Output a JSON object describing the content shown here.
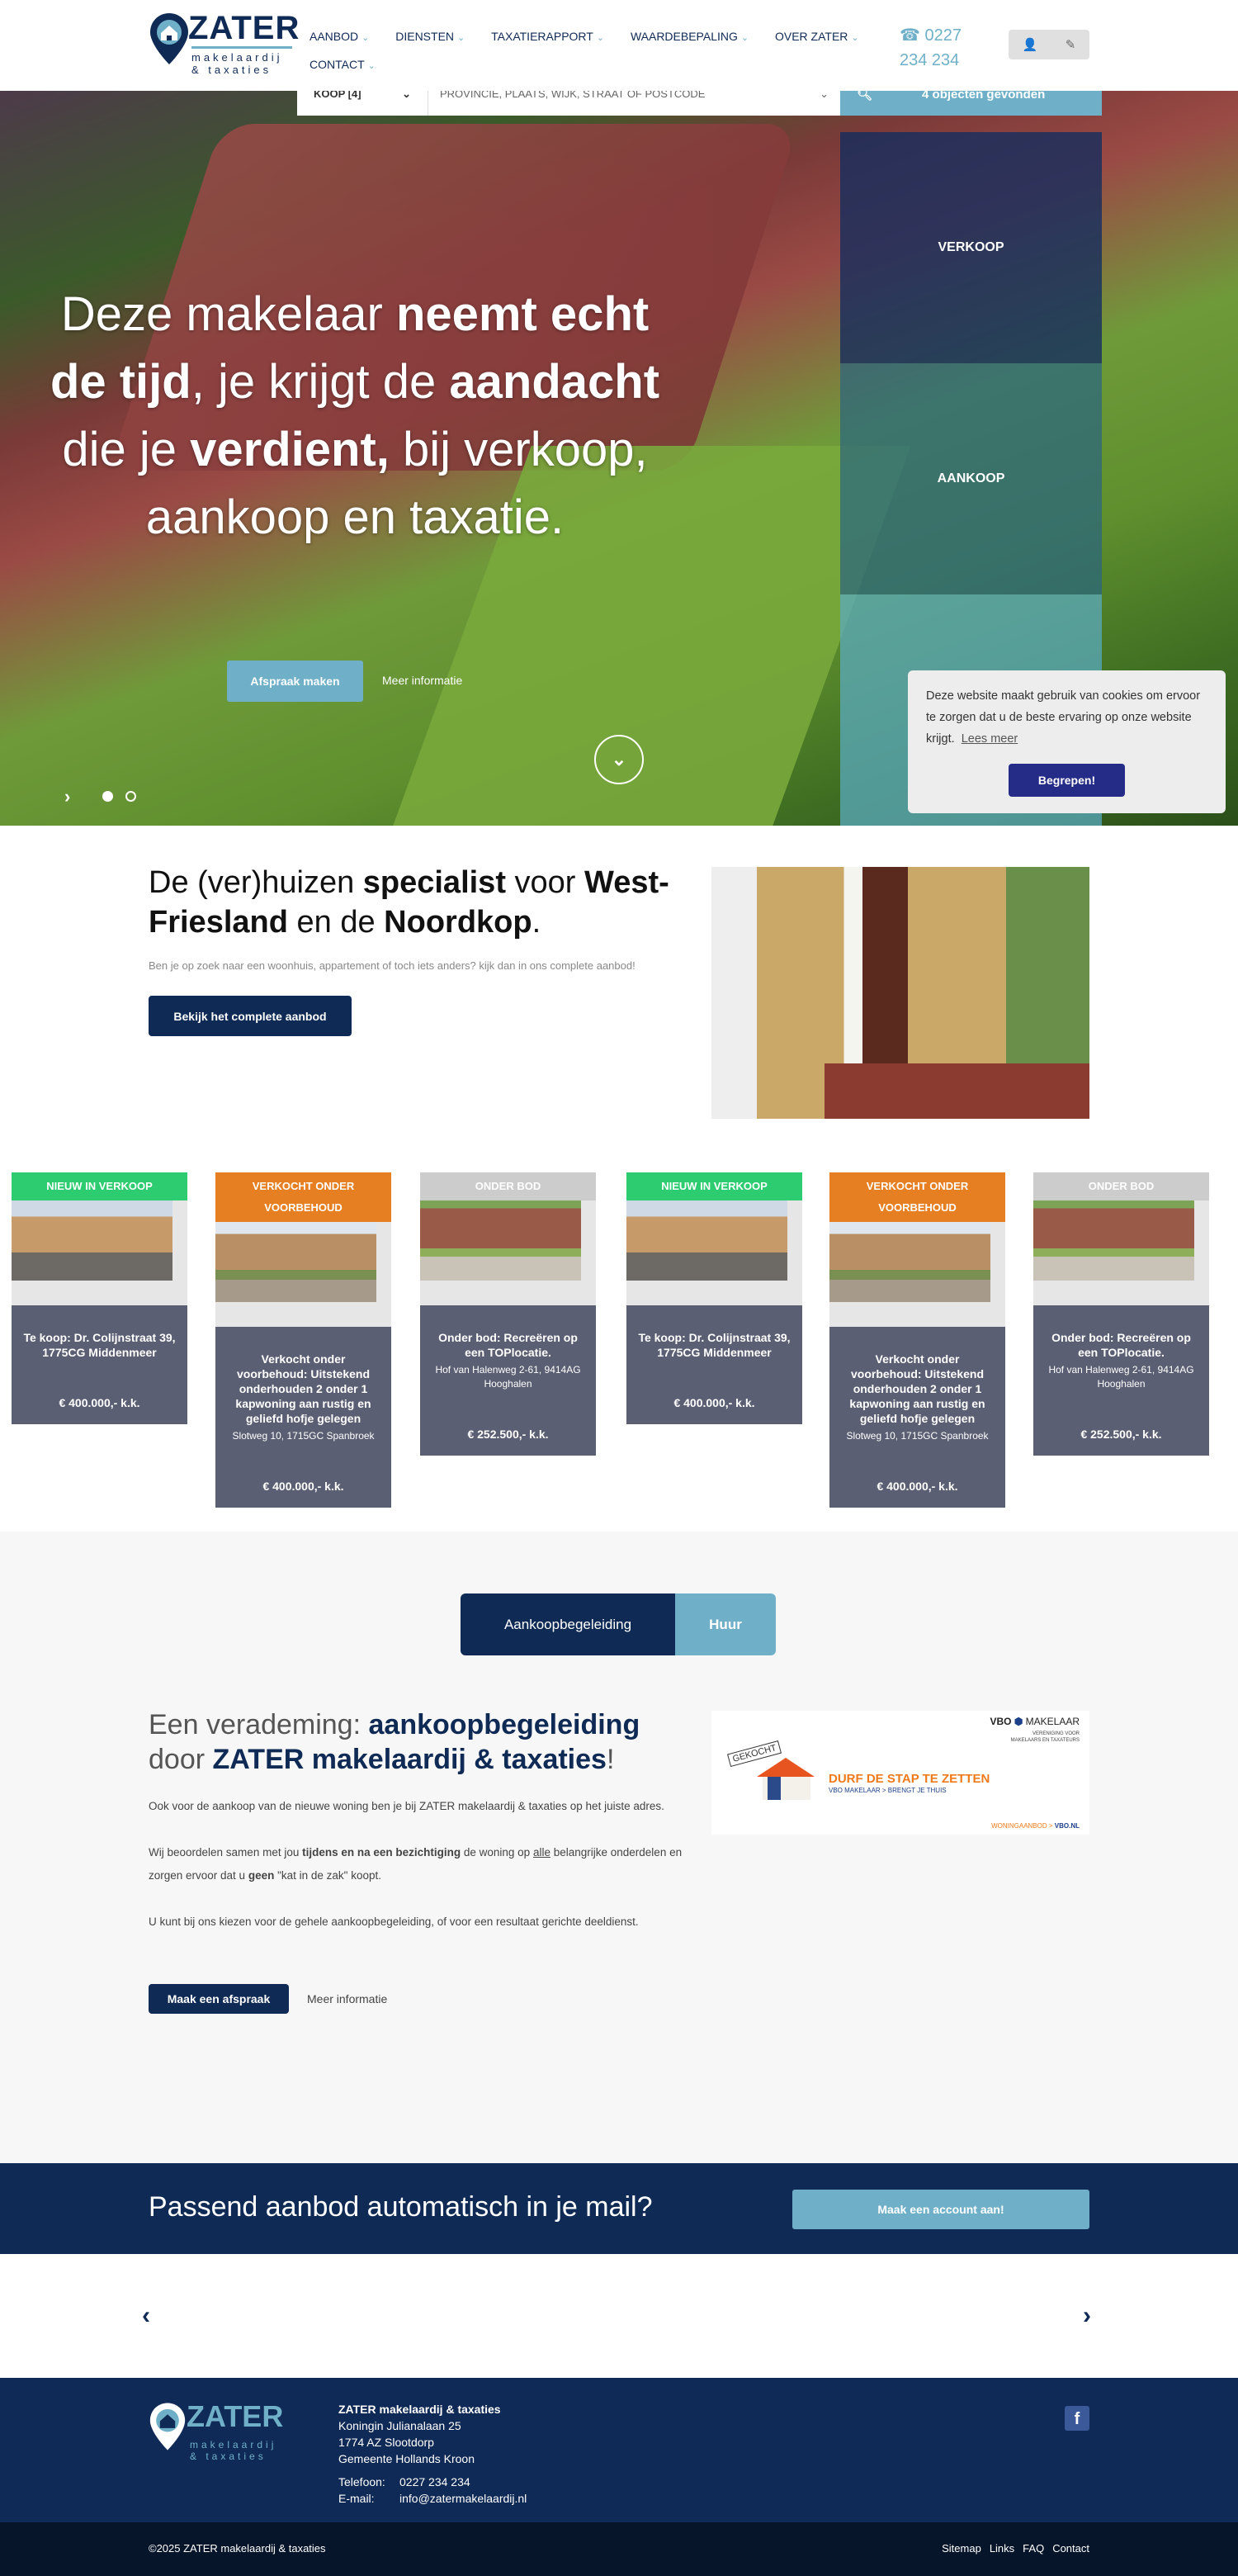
{
  "header": {
    "logo_text": "ZATER",
    "logo_sub1": "makelaardij",
    "logo_sub2": "& taxaties",
    "nav": [
      "AANBOD",
      "DIENSTEN",
      "TAXATIERAPPORT",
      "WAARDEBEPALING",
      "OVER ZATER",
      "CONTACT"
    ],
    "phone": "0227 234 234"
  },
  "search": {
    "type_value": "KOOP [4]",
    "location_placeholder": "PROVINCIE, PLAATS, WIJK, STRAAT OF POSTCODE",
    "result_label": "4 objecten gevonden"
  },
  "hero": {
    "t1": "Deze makelaar ",
    "b1": "neemt echt de tijd",
    "t2": ", je krijgt de ",
    "b2": "aandacht",
    "t3": " die je ",
    "b3": "verdient,",
    "t4": " bij verkoop, aankoop en taxatie.",
    "primary_button": "Afspraak maken",
    "secondary_link": "Meer informatie",
    "tiles": [
      "VERKOOP",
      "AANKOOP"
    ],
    "slide_count": 2,
    "active_slide": 1
  },
  "cookie": {
    "text": "Deze website maakt gebruik van cookies om ervoor te zorgen dat u de beste ervaring op onze website krijgt.",
    "link": "Lees meer",
    "button": "Begrepen!"
  },
  "specialist": {
    "t1": "De (ver)huizen ",
    "b1": "specialist",
    "t2": " voor ",
    "b2": "West-Friesland",
    "t3": " en de ",
    "b3": "Noordkop",
    "t4": ".",
    "text": "Ben je op zoek naar een woonhuis, appartement of toch iets anders? kijk dan in ons complete aanbod!",
    "button": "Bekijk het complete aanbod"
  },
  "listings": [
    {
      "label": "NIEUW IN VERKOOP",
      "color": "#2ecc71",
      "title": "Te koop: Dr. Colijnstraat 39, 1775CG Middenmeer",
      "address": "",
      "price": "€ 400.000,- k.k."
    },
    {
      "label": "VERKOCHT ONDER VOORBEHOUD",
      "color": "#e67e22",
      "title": "Verkocht onder voorbehoud: Uitstekend onderhouden 2 onder 1 kapwoning aan rustig en geliefd hofje gelegen",
      "address": "Slotweg 10, 1715GC Spanbroek",
      "price": "€ 400.000,- k.k."
    },
    {
      "label": "ONDER BOD",
      "color": "#cccccc",
      "title": "Onder bod: Recreëren op een TOPlocatie.",
      "address": "Hof van Halenweg 2-61, 9414AG Hooghalen",
      "price": "€ 252.500,- k.k."
    },
    {
      "label": "NIEUW IN VERKOOP",
      "color": "#2ecc71",
      "title": "Te koop: Dr. Colijnstraat 39, 1775CG Middenmeer",
      "address": "",
      "price": "€ 400.000,- k.k."
    },
    {
      "label": "VERKOCHT ONDER VOORBEHOUD",
      "color": "#e67e22",
      "title": "Verkocht onder voorbehoud: Uitstekend onderhouden 2 onder 1 kapwoning aan rustig en geliefd hofje gelegen",
      "address": "Slotweg 10, 1715GC Spanbroek",
      "price": "€ 400.000,- k.k."
    },
    {
      "label": "ONDER BOD",
      "color": "#cccccc",
      "title": "Onder bod: Recreëren op een TOPlocatie.",
      "address": "Hof van Halenweg 2-61, 9414AG Hooghalen",
      "price": "€ 252.500,- k.k."
    }
  ],
  "services": {
    "tabs": [
      "Aankoopbegeleiding",
      "Huur"
    ],
    "active_tab": "Aankoopbegeleiding",
    "h_t1": "Een verademing: ",
    "h_b1": "aankoopbegeleiding",
    "h_t2": " door ",
    "h_b2": "ZATER makelaardij & taxaties",
    "h_t3": "!",
    "p1": "Ook voor de aankoop van de nieuwe woning ben je bij ZATER makelaardij & taxaties op het juiste adres.",
    "p2_a": "Wij beoordelen samen met jou ",
    "p2_b": "tijdens en na een bezichtiging",
    "p2_c": " de woning op ",
    "p2_u": "alle",
    "p2_d": " belangrijke onderdelen en zorgen ervoor dat u ",
    "p2_e": "geen",
    "p2_f": " \"kat in de zak\" koopt.",
    "p3": "U kunt bij ons kiezen voor de gehele aankoopbegeleiding, of voor een resultaat gerichte deeldienst.",
    "button": "Maak een afspraak",
    "link": "Meer informatie",
    "banner": {
      "brand": "VBO",
      "brand2": "MAKELAAR",
      "tagline1": "VERENIGING VOOR",
      "tagline2": "MAKELAARS EN TAXATEURS",
      "sign": "GEKOCHT",
      "headline": "DURF DE STAP TE ZETTEN",
      "sub": "VBO MAKELAAR > BRENGT JE THUIS",
      "footer1": "WONINGAANBOD >",
      "footer2": "VBO.NL"
    }
  },
  "mail_band": {
    "t1": "Passend aanbod ",
    "b1": "automatisch",
    "t2": " in je mail?",
    "button": "Maak een account aan!"
  },
  "footer": {
    "company": "ZATER makelaardij & taxaties",
    "street": "Koningin Julianalaan 25",
    "city": "1774 AZ Slootdorp",
    "municipality": "Gemeente Hollands Kroon",
    "phone_label": "Telefoon:",
    "phone": "0227 234 234",
    "email_label": "E-mail:",
    "email": "info@zatermakelaardij.nl",
    "copyright": "©2025 ZATER makelaardij & taxaties",
    "links": [
      "Sitemap",
      "Links",
      "FAQ",
      "Contact"
    ]
  },
  "colors": {
    "navy": "#0f2a55",
    "light_blue": "#6fb0c8",
    "card_body": "#5b5f73",
    "cookie_button": "#242c87"
  }
}
